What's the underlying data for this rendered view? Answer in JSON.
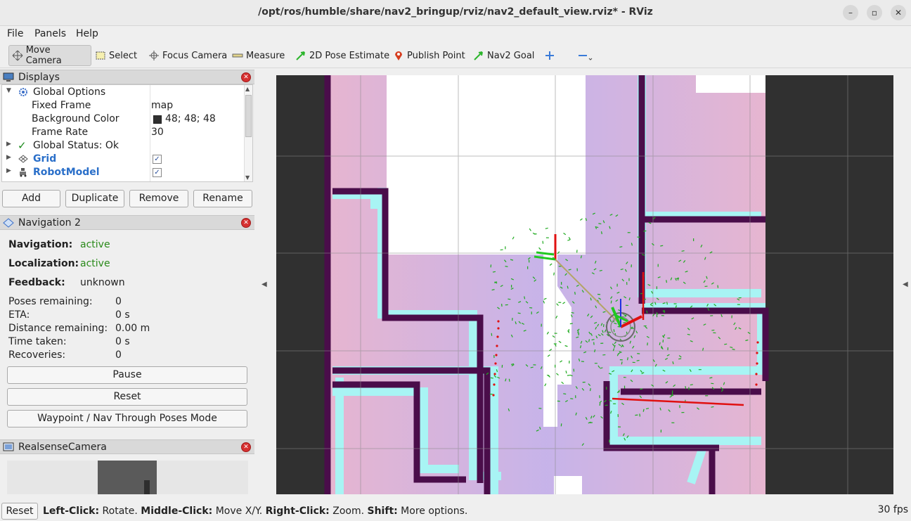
{
  "window": {
    "title": "/opt/ros/humble/share/nav2_bringup/rviz/nav2_default_view.rviz* - RViz"
  },
  "menu": {
    "file": "File",
    "panels": "Panels",
    "help": "Help"
  },
  "toolbar": {
    "move_camera": "Move Camera",
    "select": "Select",
    "focus_camera": "Focus Camera",
    "measure": "Measure",
    "pose_estimate": "2D Pose Estimate",
    "publish_point": "Publish Point",
    "nav2_goal": "Nav2 Goal"
  },
  "displays": {
    "title": "Displays",
    "rows": [
      {
        "label": "Global Options"
      },
      {
        "label": "Fixed Frame",
        "value": "map"
      },
      {
        "label": "Background Color",
        "value": "48; 48; 48",
        "color": "#303030"
      },
      {
        "label": "Frame Rate",
        "value": "30"
      },
      {
        "label": "Global Status: Ok"
      },
      {
        "label": "Grid",
        "checked": true
      },
      {
        "label": "RobotModel",
        "checked": true
      }
    ],
    "buttons": {
      "add": "Add",
      "duplicate": "Duplicate",
      "remove": "Remove",
      "rename": "Rename"
    }
  },
  "navigation": {
    "title": "Navigation 2",
    "nav_label": "Navigation:",
    "nav_value": "active",
    "loc_label": "Localization:",
    "loc_value": "active",
    "fb_label": "Feedback:",
    "fb_value": "unknown",
    "stats": [
      {
        "label": "Poses remaining:",
        "value": "0"
      },
      {
        "label": "ETA:",
        "value": "0 s"
      },
      {
        "label": "Distance remaining:",
        "value": "0.00 m"
      },
      {
        "label": "Time taken:",
        "value": "0 s"
      },
      {
        "label": "Recoveries:",
        "value": "0"
      }
    ],
    "pause": "Pause",
    "reset": "Reset",
    "waypoint": "Waypoint / Nav Through Poses Mode"
  },
  "camera": {
    "title": "RealsenseCamera"
  },
  "status": {
    "reset": "Reset",
    "hint_left": "Left-Click:",
    "hint_left_v": " Rotate. ",
    "hint_mid": "Middle-Click:",
    "hint_mid_v": " Move X/Y. ",
    "hint_right": "Right-Click:",
    "hint_right_v": " Zoom. ",
    "hint_shift": "Shift:",
    "hint_shift_v": " More options.",
    "fps": "30 fps"
  },
  "colors": {
    "accent_link": "#2a6fc9",
    "status_active": "#2a8a1a",
    "map_wall": "#4a0d4a",
    "inflation_cyan": "#a8f4f4"
  }
}
